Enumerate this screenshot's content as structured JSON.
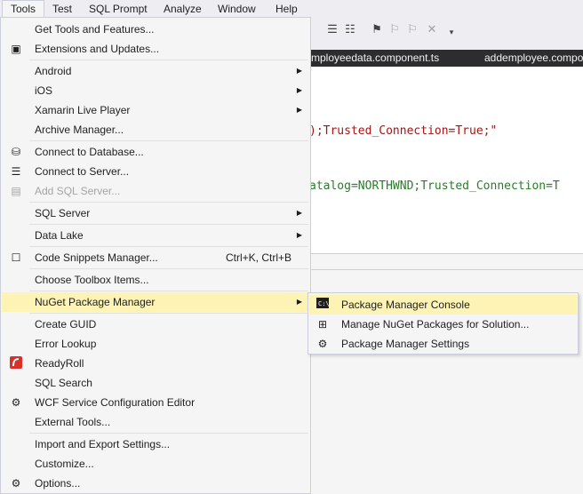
{
  "menubar": {
    "items": [
      "Tools",
      "Test",
      "SQL Prompt",
      "Analyze",
      "Window",
      "Help"
    ]
  },
  "tabs": {
    "tab1": "mployeedata.component.ts",
    "tab2": "addemployee.compo"
  },
  "editor": {
    "line1": ");Trusted_Connection=True;\"",
    "line2": "atalog=NORTHWND;Trusted_Connection=T"
  },
  "tools_menu": {
    "items": [
      {
        "label": "Get Tools and Features...",
        "icon": "none"
      },
      {
        "label": "Extensions and Updates...",
        "icon": "extensions-icon"
      },
      {
        "label": "Android",
        "icon": "none",
        "submenu": true
      },
      {
        "label": "iOS",
        "icon": "none",
        "submenu": true
      },
      {
        "label": "Xamarin Live Player",
        "icon": "none",
        "submenu": true
      },
      {
        "label": "Archive Manager...",
        "icon": "none"
      },
      {
        "label": "Connect to Database...",
        "icon": "connect-database-icon"
      },
      {
        "label": "Connect to Server...",
        "icon": "connect-server-icon"
      },
      {
        "label": "Add SQL Server...",
        "icon": "add-sql-server-icon",
        "disabled": true
      },
      {
        "label": "SQL Server",
        "icon": "none",
        "submenu": true
      },
      {
        "label": "Data Lake",
        "icon": "none",
        "submenu": true
      },
      {
        "label": "Code Snippets Manager...",
        "icon": "snippets-icon",
        "shortcut": "Ctrl+K, Ctrl+B"
      },
      {
        "label": "Choose Toolbox Items...",
        "icon": "none"
      },
      {
        "label": "NuGet Package Manager",
        "icon": "none",
        "submenu": true,
        "highlight": true
      },
      {
        "label": "Create GUID",
        "icon": "none"
      },
      {
        "label": "Error Lookup",
        "icon": "none"
      },
      {
        "label": "ReadyRoll",
        "icon": "readyroll-icon"
      },
      {
        "label": "SQL Search",
        "icon": "none"
      },
      {
        "label": "WCF Service Configuration Editor",
        "icon": "wcf-config-icon"
      },
      {
        "label": "External Tools...",
        "icon": "none"
      },
      {
        "label": "Import and Export Settings...",
        "icon": "none"
      },
      {
        "label": "Customize...",
        "icon": "none"
      },
      {
        "label": "Options...",
        "icon": "gear-icon"
      }
    ]
  },
  "nuget_submenu": {
    "items": [
      {
        "label": "Package Manager Console",
        "icon": "console-icon",
        "highlight": true
      },
      {
        "label": "Manage NuGet Packages for Solution...",
        "icon": "package-icon"
      },
      {
        "label": "Package Manager Settings",
        "icon": "gear-icon"
      }
    ]
  },
  "colors": {
    "menu_bg": "#f5f5f5",
    "highlight": "#fcf3b5",
    "tab_bar": "#2d2d30",
    "string_color": "#a31515",
    "green_text": "#2b7a2b"
  }
}
